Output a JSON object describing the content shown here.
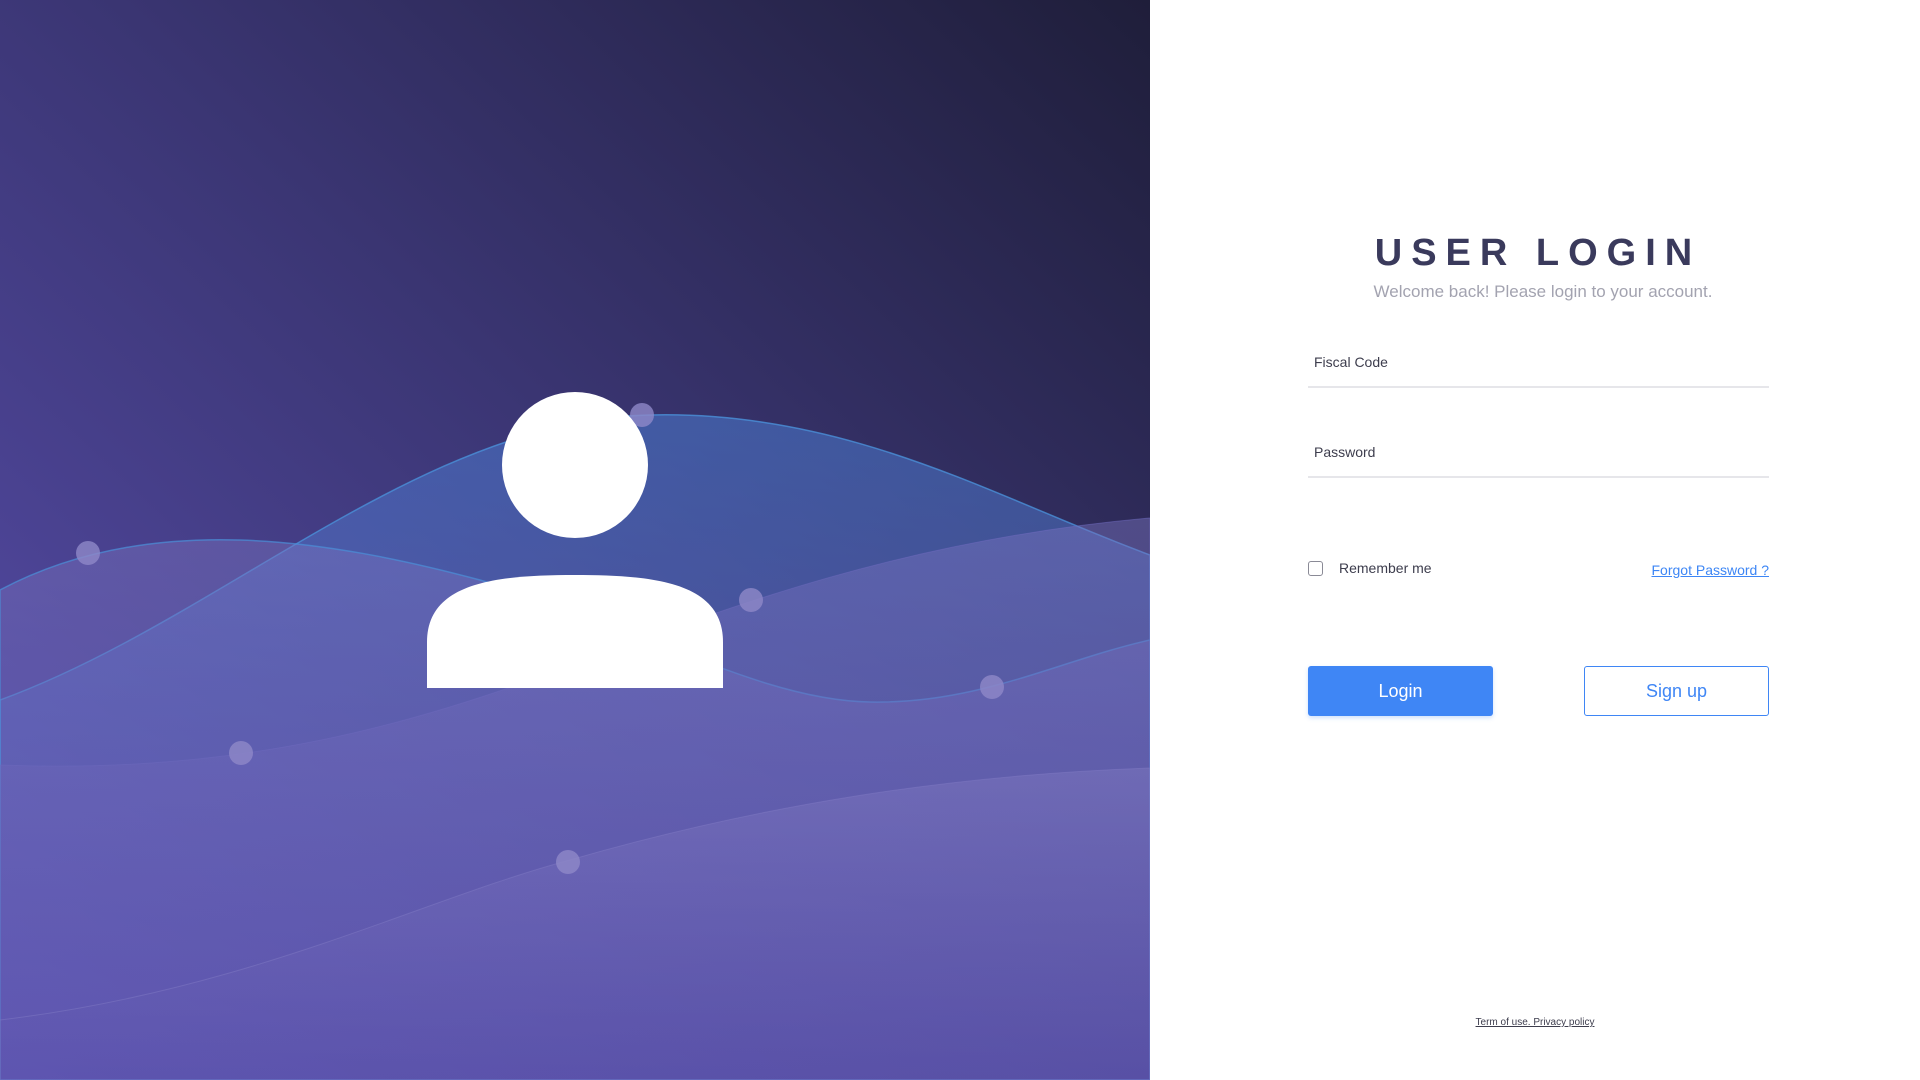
{
  "login": {
    "title": "USER LOGIN",
    "subtitle": "Welcome back! Please login to your account.",
    "fiscal_code_placeholder": "Fiscal Code",
    "password_placeholder": "Password",
    "remember_label": "Remember me",
    "remember_checked": false,
    "forgot_label": "Forgot Password ?",
    "login_label": "Login",
    "signup_label": "Sign up",
    "footer_label": "Term of use. Privacy policy"
  },
  "icons": {
    "avatar": "user-avatar-icon"
  },
  "colors": {
    "hero_dark": "#222040",
    "hero_mid": "#3a3570",
    "hero_light": "#5a4ea8",
    "primary": "#3f86f5",
    "title": "#3a3a5c",
    "subtitle": "#a3a3b0"
  }
}
